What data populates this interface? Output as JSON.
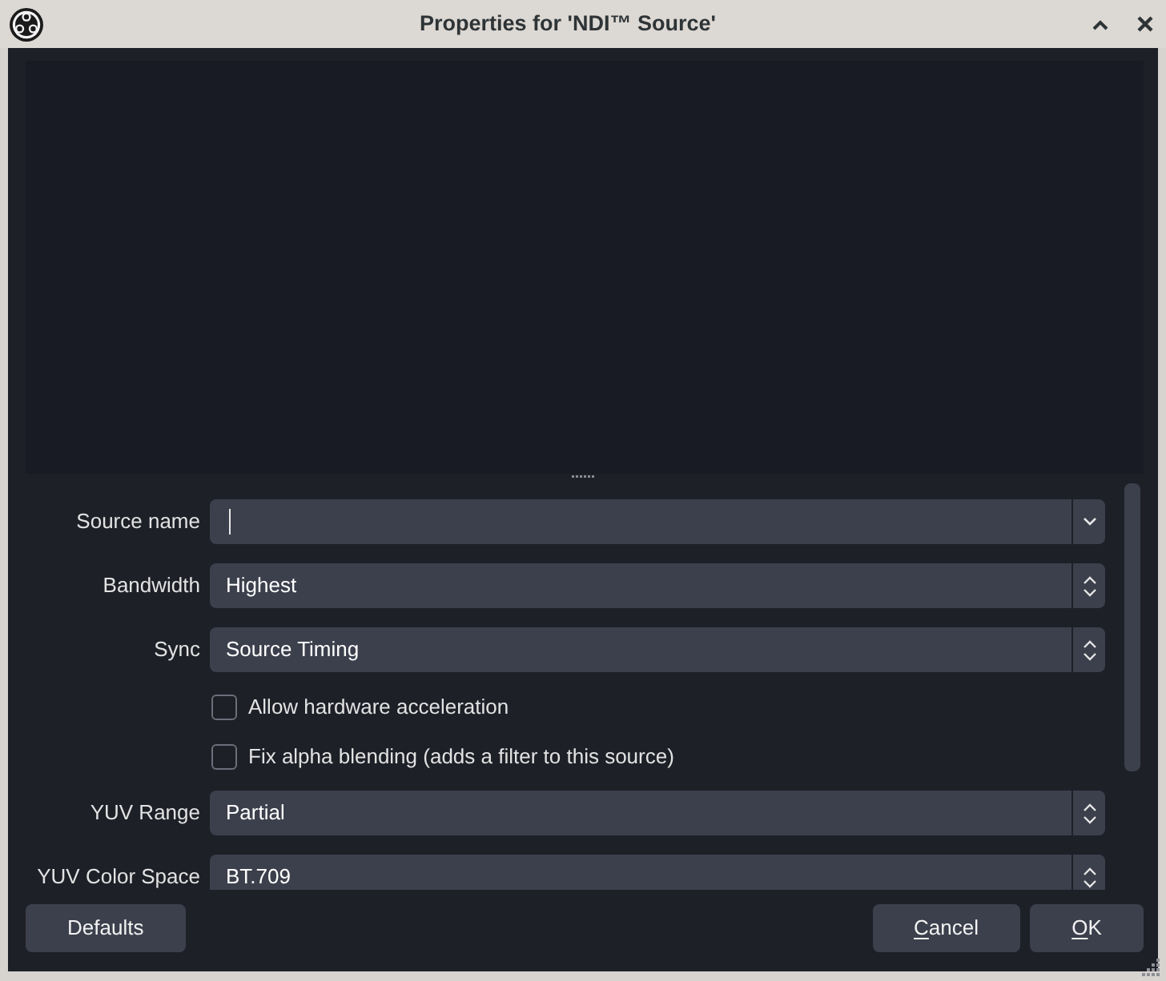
{
  "window": {
    "title": "Properties for 'NDI™ Source'"
  },
  "properties": [
    {
      "kind": "editable_combo",
      "label": "Source name",
      "focused": true
    },
    {
      "kind": "combo",
      "label": "Bandwidth",
      "value": "Highest"
    },
    {
      "kind": "combo",
      "label": "Sync",
      "value": "Source Timing"
    },
    {
      "kind": "checkbox",
      "label": "Allow hardware acceleration",
      "checked": false
    },
    {
      "kind": "checkbox",
      "label": "Fix alpha blending (adds a filter to this source)",
      "checked": false
    },
    {
      "kind": "combo",
      "label": "YUV Range",
      "value": "Partial"
    },
    {
      "kind": "combo",
      "label": "YUV Color Space",
      "value": "BT.709"
    }
  ],
  "buttons": {
    "left": [
      {
        "label": "Defaults",
        "mnemonic": false
      }
    ],
    "right": [
      {
        "label": "Cancel",
        "mnemonic": true
      },
      {
        "label": "OK",
        "mnemonic": true
      }
    ]
  }
}
